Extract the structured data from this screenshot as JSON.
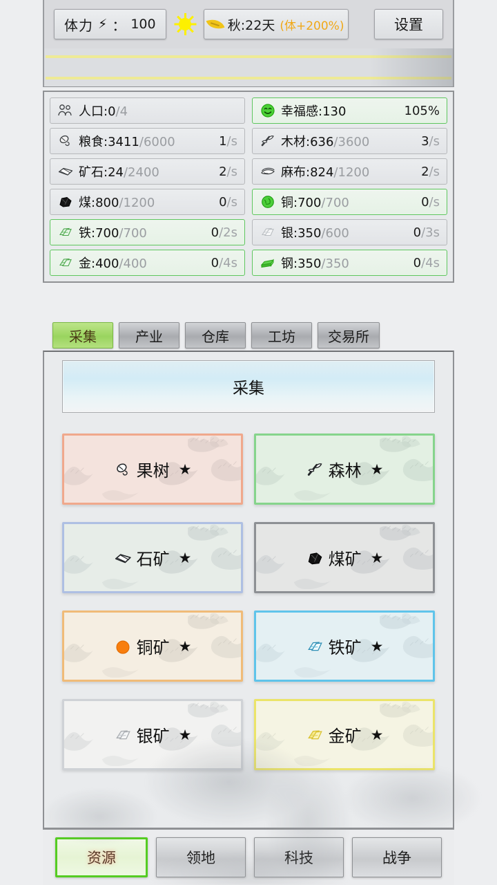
{
  "topbar": {
    "stamina_label": "体力",
    "stamina_bolt": "⚡",
    "stamina_sep": "：",
    "stamina_value": "100",
    "sun_icon": "sun-icon",
    "season_icon": "leaf-icon",
    "season_text": "秋:22天",
    "season_bonus": "(体+200%)",
    "settings_label": "设置"
  },
  "resources": {
    "rows": [
      [
        {
          "icon": "population-icon",
          "name": "人口:",
          "current": "0",
          "cap": "/4",
          "rate": "",
          "unit": "",
          "full": false
        },
        {
          "icon": "happiness-icon",
          "name": "幸福感:",
          "current": "130",
          "cap": "",
          "rate": "105%",
          "unit": "",
          "full": true
        }
      ],
      [
        {
          "icon": "food-icon",
          "name": "粮食:",
          "current": "3411",
          "cap": "/6000",
          "rate": "1",
          "unit": "/s",
          "full": false
        },
        {
          "icon": "wood-icon",
          "name": "木材:",
          "current": "636",
          "cap": "/3600",
          "rate": "3",
          "unit": "/s",
          "full": false
        }
      ],
      [
        {
          "icon": "ore-icon",
          "name": "矿石:",
          "current": "24",
          "cap": "/2400",
          "rate": "2",
          "unit": "/s",
          "full": false
        },
        {
          "icon": "cloth-icon",
          "name": "麻布:",
          "current": "824",
          "cap": "/1200",
          "rate": "2",
          "unit": "/s",
          "full": false
        }
      ],
      [
        {
          "icon": "coal-icon",
          "name": "煤:",
          "current": "800",
          "cap": "/1200",
          "rate": "0",
          "unit": "/s",
          "full": false
        },
        {
          "icon": "copper-icon",
          "name": "铜:",
          "current": "700",
          "cap": "/700",
          "rate": "0",
          "unit": "/s",
          "full": true
        }
      ],
      [
        {
          "icon": "iron-icon",
          "name": "铁:",
          "current": "700",
          "cap": "/700",
          "rate": "0",
          "unit": "/2s",
          "full": true
        },
        {
          "icon": "silver-icon",
          "name": "银:",
          "current": "350",
          "cap": "/600",
          "rate": "0",
          "unit": "/3s",
          "full": false
        }
      ],
      [
        {
          "icon": "gold-icon",
          "name": "金:",
          "current": "400",
          "cap": "/400",
          "rate": "0",
          "unit": "/4s",
          "full": true
        },
        {
          "icon": "steel-icon",
          "name": "钢:",
          "current": "350",
          "cap": "/350",
          "rate": "0",
          "unit": "/4s",
          "full": true
        }
      ]
    ]
  },
  "tabs": [
    {
      "label": "采集",
      "active": true
    },
    {
      "label": "产业",
      "active": false
    },
    {
      "label": "仓库",
      "active": false
    },
    {
      "label": "工坊",
      "active": false
    },
    {
      "label": "交易所",
      "active": false
    }
  ],
  "panel": {
    "title": "采集",
    "cards": [
      {
        "icon": "fruit-tree-icon",
        "label": "果树",
        "star": "★",
        "border": "#f0a88c",
        "tint": "rgba(244,200,186,0.38)"
      },
      {
        "icon": "forest-icon",
        "label": "森林",
        "star": "★",
        "border": "#86d48c",
        "tint": "rgba(196,232,200,0.36)"
      },
      {
        "icon": "stone-mine-icon",
        "label": "石矿",
        "star": "★",
        "border": "#aebfe3",
        "tint": "rgba(206,224,214,0.34)"
      },
      {
        "icon": "coal-mine-icon",
        "label": "煤矿",
        "star": "★",
        "border": "#8d9094",
        "tint": "rgba(200,202,205,0.34)"
      },
      {
        "icon": "copper-mine-icon",
        "label": "铜矿",
        "star": "★",
        "border": "#f0bb78",
        "tint": "rgba(248,226,198,0.36)"
      },
      {
        "icon": "iron-mine-icon",
        "label": "铁矿",
        "star": "★",
        "border": "#5fc4ea",
        "tint": "rgba(206,235,246,0.40)"
      },
      {
        "icon": "silver-mine-icon",
        "label": "银矿",
        "star": "★",
        "border": "#cfd2d6",
        "tint": "rgba(238,239,240,0.30)"
      },
      {
        "icon": "gold-mine-icon",
        "label": "金矿",
        "star": "★",
        "border": "#ebe469",
        "tint": "rgba(248,246,206,0.40)"
      }
    ]
  },
  "bottomnav": [
    {
      "label": "资源",
      "active": true
    },
    {
      "label": "领地",
      "active": false
    },
    {
      "label": "科技",
      "active": false
    },
    {
      "label": "战争",
      "active": false
    }
  ]
}
